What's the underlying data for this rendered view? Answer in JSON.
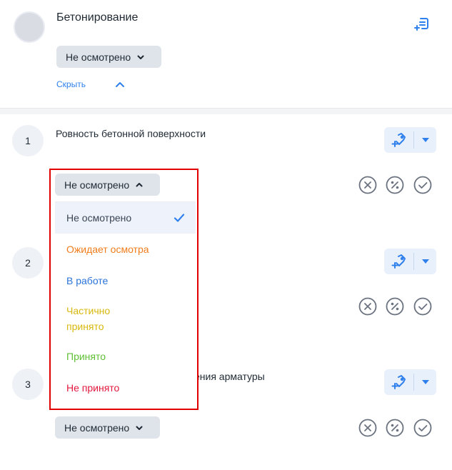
{
  "header": {
    "title": "Бетонирование",
    "status": "Не осмотрено",
    "hide_label": "Скрыть"
  },
  "items": [
    {
      "number": "1",
      "title": "Ровность бетонной поверхности",
      "status": "Не осмотрено"
    },
    {
      "number": "2",
      "title": "",
      "status": ""
    },
    {
      "number": "3",
      "title": "ения арматуры",
      "status": "Не осмотрено"
    }
  ],
  "dropdown": {
    "options": [
      {
        "label": "Не осмотрено",
        "color": "#3b4554",
        "selected": true
      },
      {
        "label": "Ожидает осмотра",
        "color": "#f07c1b",
        "selected": false
      },
      {
        "label": "В работе",
        "color": "#2b74d9",
        "selected": false
      },
      {
        "label": "Частично принято",
        "color": "#d9b80c",
        "selected": false
      },
      {
        "label": "Принято",
        "color": "#5fbf35",
        "selected": false
      },
      {
        "label": "Не принято",
        "color": "#e3173d",
        "selected": false
      }
    ]
  },
  "icons": {
    "report": "report-plus-icon",
    "add_tag": "add-tag-icon",
    "dropdown_arrow": "caret-down-icon",
    "reject": "x-circle-icon",
    "partial": "percent-circle-icon",
    "accept": "check-circle-icon",
    "checkmark": "checkmark-icon"
  },
  "colors": {
    "accent": "#2f80ed",
    "highlight_border": "#e00000",
    "status_bg": "#dfe3ea",
    "action_bg": "#e8f0fc"
  }
}
